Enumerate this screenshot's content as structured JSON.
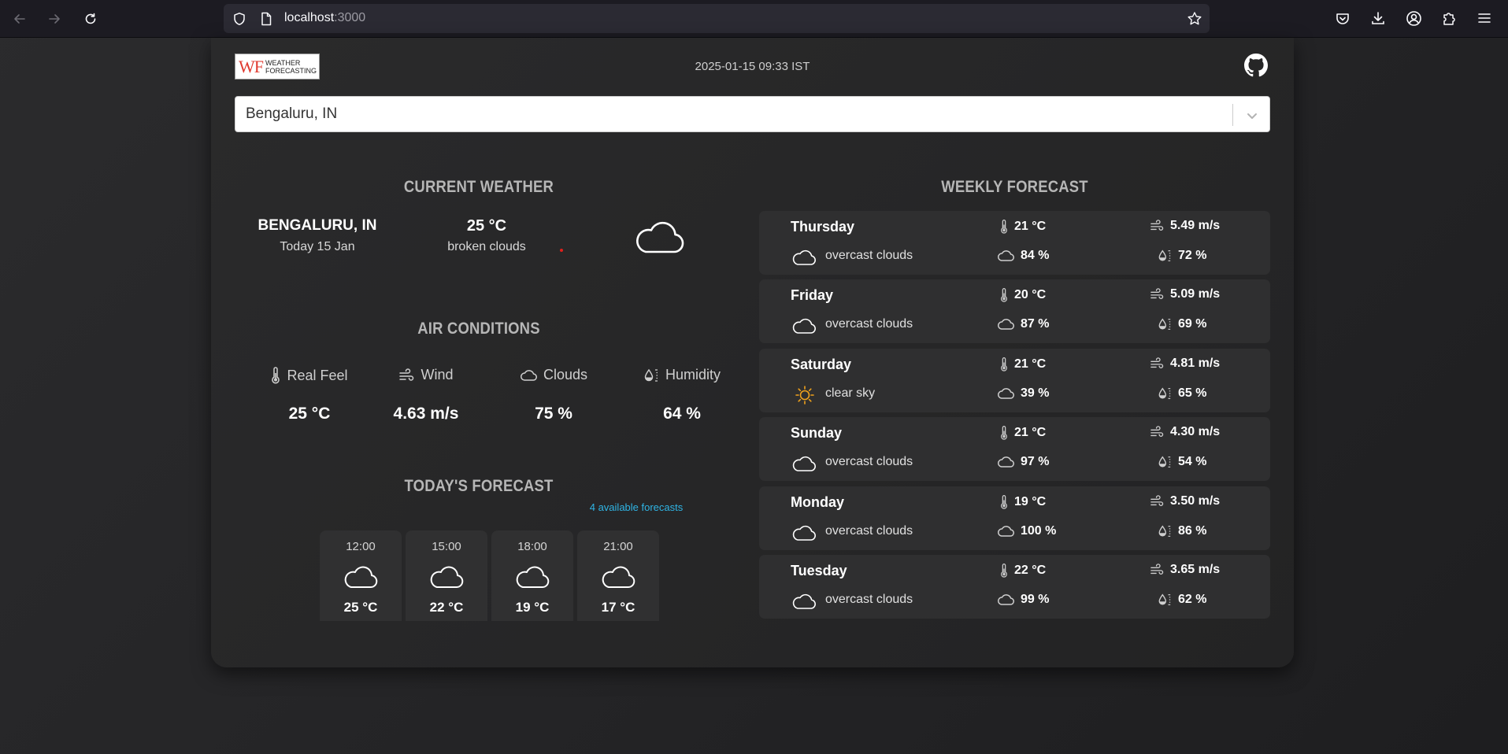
{
  "browser": {
    "url_host": "localhost",
    "url_port": ":3000"
  },
  "header": {
    "logo_mark": "WF",
    "logo_line1": "WEATHER",
    "logo_line2": "FORECASTING",
    "datetime": "2025-01-15 09:33 IST"
  },
  "search": {
    "value": "Bengaluru, IN"
  },
  "current_weather": {
    "title": "CURRENT WEATHER",
    "city": "BENGALURU, IN",
    "date": "Today 15 Jan",
    "temperature": "25 °C",
    "description": "broken clouds",
    "icon": "cloud-icon"
  },
  "air_conditions": {
    "title": "AIR CONDITIONS",
    "items": [
      {
        "label": "Real Feel",
        "value": "25 °C",
        "icon": "thermometer-icon"
      },
      {
        "label": "Wind",
        "value": "4.63 m/s",
        "icon": "wind-icon"
      },
      {
        "label": "Clouds",
        "value": "75 %",
        "icon": "cloud-icon"
      },
      {
        "label": "Humidity",
        "value": "64 %",
        "icon": "humidity-icon"
      }
    ]
  },
  "todays_forecast": {
    "title": "TODAY'S FORECAST",
    "subtitle": "4 available forecasts",
    "items": [
      {
        "time": "12:00",
        "temperature": "25 °C",
        "icon": "cloud-icon"
      },
      {
        "time": "15:00",
        "temperature": "22 °C",
        "icon": "cloud-icon"
      },
      {
        "time": "18:00",
        "temperature": "19 °C",
        "icon": "cloud-icon"
      },
      {
        "time": "21:00",
        "temperature": "17 °C",
        "icon": "cloud-icon"
      }
    ]
  },
  "weekly_forecast": {
    "title": "WEEKLY FORECAST",
    "days": [
      {
        "day": "Thursday",
        "temp": "21 °C",
        "wind": "5.49 m/s",
        "description": "overcast clouds",
        "clouds": "84 %",
        "humidity": "72 %",
        "icon": "cloud-icon"
      },
      {
        "day": "Friday",
        "temp": "20 °C",
        "wind": "5.09 m/s",
        "description": "overcast clouds",
        "clouds": "87 %",
        "humidity": "69 %",
        "icon": "cloud-icon"
      },
      {
        "day": "Saturday",
        "temp": "21 °C",
        "wind": "4.81 m/s",
        "description": "clear sky",
        "clouds": "39 %",
        "humidity": "65 %",
        "icon": "sun-icon"
      },
      {
        "day": "Sunday",
        "temp": "21 °C",
        "wind": "4.30 m/s",
        "description": "overcast clouds",
        "clouds": "97 %",
        "humidity": "54 %",
        "icon": "cloud-icon"
      },
      {
        "day": "Monday",
        "temp": "19 °C",
        "wind": "3.50 m/s",
        "description": "overcast clouds",
        "clouds": "100 %",
        "humidity": "86 %",
        "icon": "cloud-icon"
      },
      {
        "day": "Tuesday",
        "temp": "22 °C",
        "wind": "3.65 m/s",
        "description": "overcast clouds",
        "clouds": "99 %",
        "humidity": "62 %",
        "icon": "cloud-icon"
      }
    ]
  },
  "colors": {
    "accent": "#2fb4e4",
    "sun": "#f0a21c",
    "logo_red": "#e03a2f"
  }
}
